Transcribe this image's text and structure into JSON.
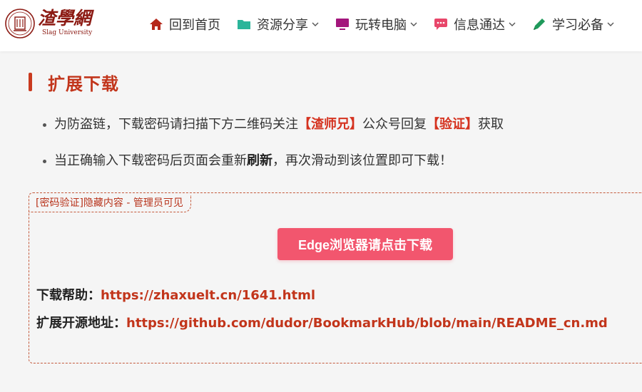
{
  "brand": {
    "logo_text": "渣學網",
    "logo_subtitle": "Slag University",
    "color": "#8c1a13"
  },
  "nav": {
    "items": [
      {
        "label": "回到首页",
        "icon": "home-icon",
        "icon_color": "#b5281b",
        "dropdown": false
      },
      {
        "label": "资源分享",
        "icon": "folder-icon",
        "icon_color": "#2bb59a",
        "dropdown": true
      },
      {
        "label": "玩转电脑",
        "icon": "monitor-icon",
        "icon_color": "#a3157c",
        "dropdown": true
      },
      {
        "label": "信息通达",
        "icon": "chat-icon",
        "icon_color": "#e8466a",
        "dropdown": true
      },
      {
        "label": "学习必备",
        "icon": "pen-icon",
        "icon_color": "#1f9a5b",
        "dropdown": true
      }
    ]
  },
  "section": {
    "title": "扩展下载",
    "accent": "#c93a1f"
  },
  "bullets": {
    "b1_pre": "为防盗链，下载密码请扫描下方二维码关注",
    "b1_hl1": "【渣师兄】",
    "b1_mid": "公众号回复",
    "b1_hl2": "【验证】",
    "b1_post": "获取",
    "b2_pre": "当正确输入下载密码后页面会重新",
    "b2_strong": "刷新",
    "b2_post": "，再次滑动到该位置即可下载！"
  },
  "hidden_box": {
    "tag": "[密码验证]隐藏内容 - 管理员可见"
  },
  "download": {
    "button_label": "Edge浏览器请点击下载",
    "button_color": "#f2566e"
  },
  "info": {
    "help_label": "下载帮助：",
    "help_url": "https://zhaxuelt.cn/1641.html",
    "source_label": "扩展开源地址：",
    "source_url": "https://github.com/dudor/BookmarkHub/blob/main/README_cn.md"
  }
}
